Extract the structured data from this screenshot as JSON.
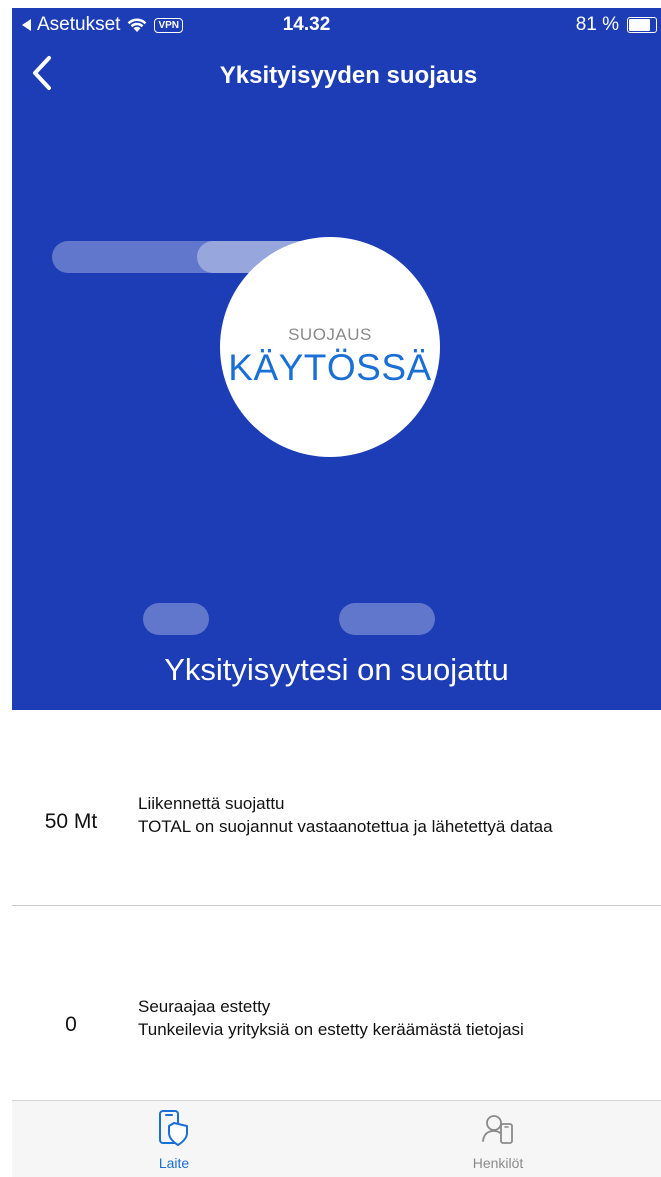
{
  "status_bar": {
    "back_app_label": "Asetukset",
    "vpn_label": "VPN",
    "time": "14.32",
    "battery_percent_label": "81 %",
    "battery_level": 0.81
  },
  "nav": {
    "title": "Yksityisyyden suojaus"
  },
  "protection": {
    "label": "SUOJAUS",
    "status": "KÄYTÖSSÄ",
    "message": "Yksityisyytesi on suojattu"
  },
  "stats": [
    {
      "value": "50 Mt",
      "title": "Liikennettä suojattu",
      "description": "TOTAL on suojannut vastaanotettua ja lähetettyä dataa"
    },
    {
      "value": "0",
      "title": "Seuraajaa estetty",
      "description": "Tunkeilevia yrityksiä on estetty keräämästä tietojasi"
    }
  ],
  "tabs": [
    {
      "label": "Laite",
      "icon": "phone-shield-icon",
      "active": true
    },
    {
      "label": "Henkilöt",
      "icon": "person-phone-icon",
      "active": false
    }
  ],
  "colors": {
    "brand_blue": "#1c3db5",
    "accent_blue": "#1a6fd6",
    "inactive_gray": "#8a8a8a"
  }
}
